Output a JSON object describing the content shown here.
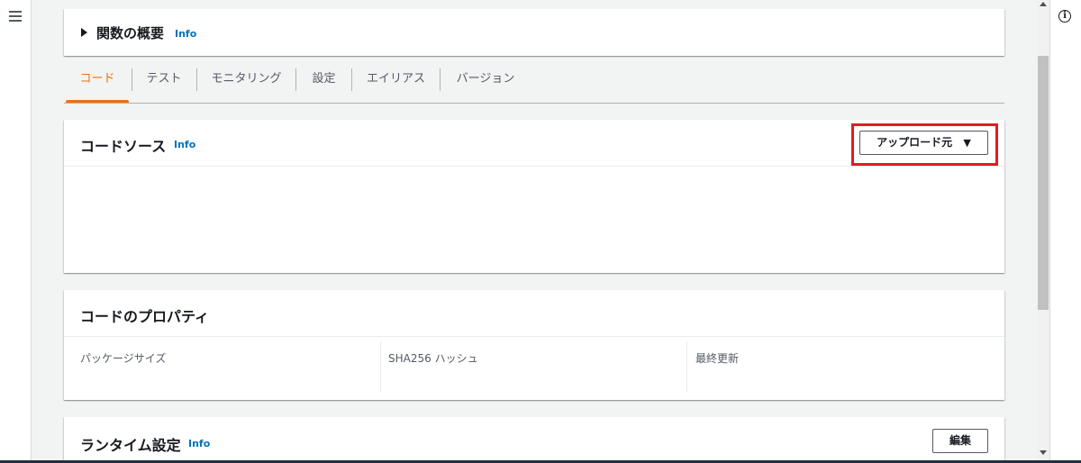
{
  "function_overview": {
    "title": "関数の概要",
    "info": "Info",
    "toggle_icon": "caret-right-icon"
  },
  "tabs": [
    {
      "label": "コード",
      "active": true
    },
    {
      "label": "テスト"
    },
    {
      "label": "モニタリング"
    },
    {
      "label": "設定"
    },
    {
      "label": "エイリアス"
    },
    {
      "label": "バージョン"
    }
  ],
  "code_source": {
    "title": "コードソース",
    "info": "Info",
    "upload_button": {
      "label": "アップロード元",
      "caret": "▼"
    }
  },
  "code_properties": {
    "title": "コードのプロパティ",
    "columns": [
      "パッケージサイズ",
      "SHA256 ハッシュ",
      "最終更新"
    ]
  },
  "runtime_settings": {
    "title": "ランタイム設定",
    "info": "Info",
    "edit_button": "編集"
  },
  "colors": {
    "accent_tab": "#ec7211",
    "link": "#0073bb",
    "highlight_box": "#e31b23"
  }
}
